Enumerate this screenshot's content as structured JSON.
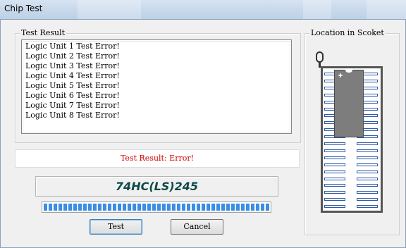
{
  "window": {
    "title": "Chip Test"
  },
  "test_result": {
    "group_label": "Test Result",
    "lines": [
      "Logic Unit 1 Test Error!",
      "Logic Unit 2 Test Error!",
      "Logic Unit 3 Test Error!",
      "Logic Unit 4 Test Error!",
      "Logic Unit 5 Test Error!",
      "Logic Unit 6 Test Error!",
      "Logic Unit 7 Test Error!",
      "Logic Unit 8 Test Error!"
    ],
    "status_text": "Test Result:  Error!"
  },
  "chip": {
    "name": "74HC(LS)245"
  },
  "progress": {
    "fraction": 1.0
  },
  "socket": {
    "group_label": "Location in Scoket",
    "pins_per_side": 20,
    "chip_pins_per_side": 10
  },
  "buttons": {
    "test": "Test",
    "cancel": "Cancel"
  },
  "colors": {
    "status_text": "#d00000",
    "chip_name": "#0d4a4a",
    "progress": "#3a8ee6",
    "pin_outline": "#2f5aa8",
    "chip_body": "#7d7d7d"
  }
}
